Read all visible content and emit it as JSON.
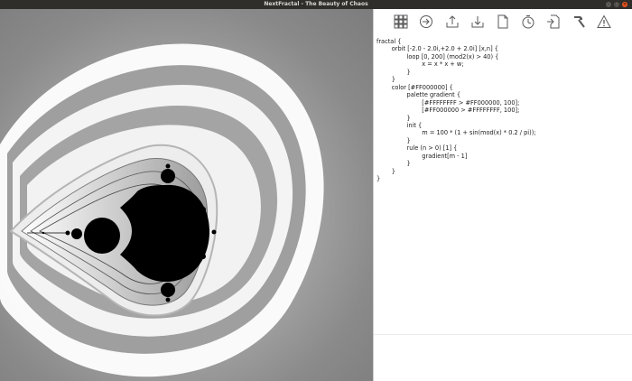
{
  "window": {
    "title": "NextFractal - The Beauty of Chaos",
    "close_glyph": "×",
    "minimize_glyph": "–",
    "maximize_glyph": "□"
  },
  "toolbar": {
    "buttons": [
      {
        "icon": "grid-icon",
        "action": "tiles"
      },
      {
        "icon": "browse-icon",
        "action": "browse"
      },
      {
        "icon": "export-icon",
        "action": "export"
      },
      {
        "icon": "import-icon",
        "action": "import"
      },
      {
        "icon": "save-file-icon",
        "action": "save"
      },
      {
        "icon": "history-icon",
        "action": "history"
      },
      {
        "icon": "open-file-icon",
        "action": "open"
      },
      {
        "icon": "hammer-icon",
        "action": "build"
      },
      {
        "icon": "warning-icon",
        "action": "errors"
      }
    ]
  },
  "editor": {
    "lines": [
      "fractal {",
      "        orbit [-2.0 - 2.0i,+2.0 + 2.0i] [x,n] {",
      "                loop [0, 200] (mod2(x) > 40) {",
      "                        x = x * x + w;",
      "                }",
      "        }",
      "        color [#FF000000] {",
      "                palette gradient {",
      "                        [#FFFFFFFF > #FF000000, 100];",
      "                        [#FF000000 > #FFFFFFFF, 100];",
      "                }",
      "                init {",
      "                        m = 100 * (1 + sin(mod(x) * 0.2 / pi));",
      "                }",
      "                rule (n > 0) [1] {",
      "                        gradient[m - 1]",
      "                }",
      "        }",
      "}"
    ]
  },
  "colors": {
    "titlebar": "#2f2e2b",
    "close_button": "#e95420",
    "fractal_background": "#8f8f8f",
    "icon": "#5a5a5a"
  }
}
